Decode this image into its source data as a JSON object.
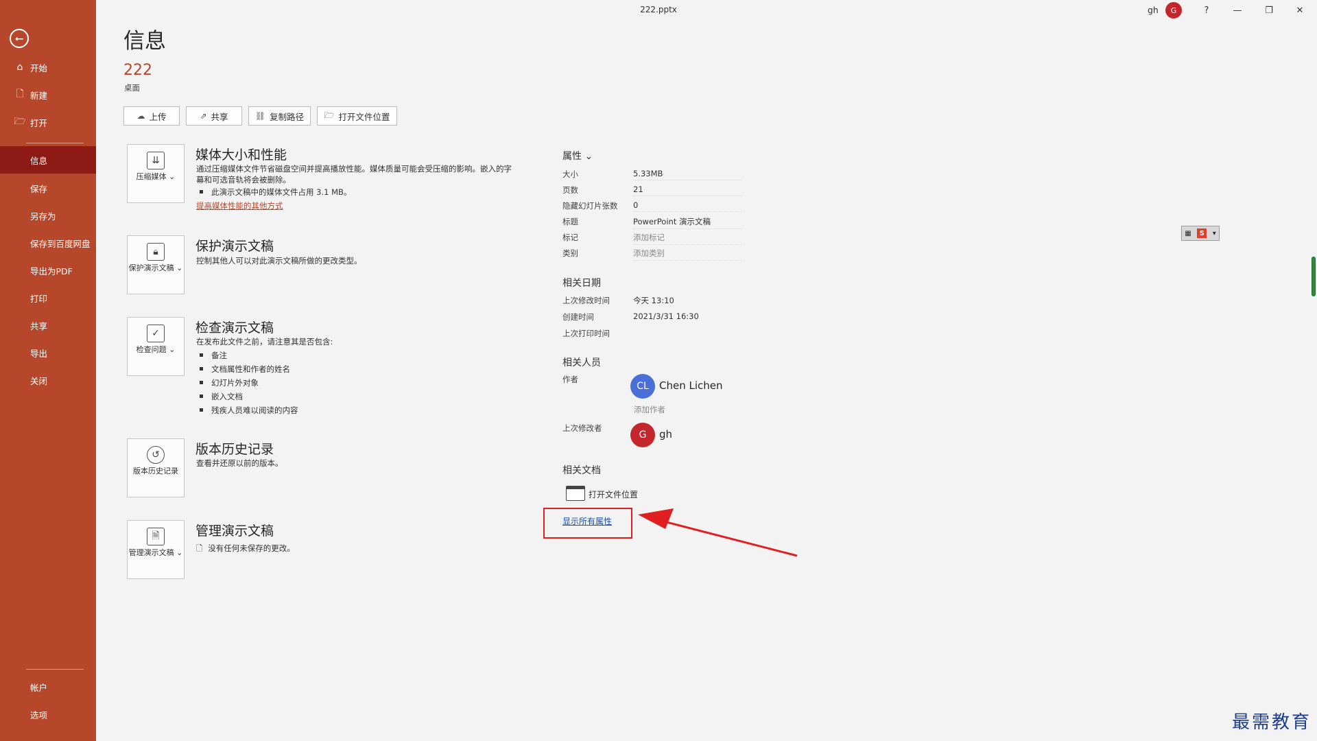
{
  "window": {
    "title": "222.pptx",
    "user": "gh",
    "user_avatar": "G",
    "help": "?",
    "minimize": "—",
    "restore": "❐",
    "close": "✕"
  },
  "sidebar": {
    "back_icon": "⭠",
    "items": [
      {
        "label": "开始",
        "icon": "⌂"
      },
      {
        "label": "新建",
        "icon": "🗋"
      },
      {
        "label": "打开",
        "icon": "🗁"
      },
      {
        "label": "信息"
      },
      {
        "label": "保存"
      },
      {
        "label": "另存为"
      },
      {
        "label": "保存到百度网盘"
      },
      {
        "label": "导出为PDF"
      },
      {
        "label": "打印"
      },
      {
        "label": "共享"
      },
      {
        "label": "导出"
      },
      {
        "label": "关闭"
      }
    ],
    "bottom": [
      {
        "label": "帐户"
      },
      {
        "label": "选项"
      }
    ],
    "colors": {
      "sidebar": "#b7472a",
      "active": "#8e1a16"
    }
  },
  "header": {
    "title": "信息",
    "file_name": "222",
    "location": "桌面",
    "buttons": [
      {
        "label": "上传",
        "icon": "☁"
      },
      {
        "label": "共享",
        "icon": "⇗"
      },
      {
        "label": "复制路径",
        "icon": "⛓"
      },
      {
        "label": "打开文件位置",
        "icon": "🗁"
      }
    ]
  },
  "sections": {
    "media": {
      "tile": "压缩媒体 ⌄",
      "title": "媒体大小和性能",
      "desc": "通过压缩媒体文件节省磁盘空间并提高播放性能。媒体质量可能会受压缩的影响。嵌入的字幕和可选音轨将会被删除。",
      "bullets": [
        "此演示文稿中的媒体文件占用 3.1 MB。"
      ],
      "link": "提高媒体性能的其他方式"
    },
    "protect": {
      "tile": "保护演示文稿 ⌄",
      "title": "保护演示文稿",
      "desc": "控制其他人可以对此演示文稿所做的更改类型。"
    },
    "inspect": {
      "tile": "检查问题 ⌄",
      "title": "检查演示文稿",
      "desc": "在发布此文件之前，请注意其是否包含:",
      "bullets": [
        "备注",
        "文档属性和作者的姓名",
        "幻灯片外对象",
        "嵌入文档",
        "残疾人员难以阅读的内容"
      ]
    },
    "history": {
      "tile": "版本历史记录",
      "title": "版本历史记录",
      "desc": "查看并还原以前的版本。"
    },
    "manage": {
      "tile": "管理演示文稿 ⌄",
      "title": "管理演示文稿",
      "desc": "没有任何未保存的更改。"
    }
  },
  "properties": {
    "heading": "属性 ⌄",
    "rows": [
      {
        "label": "大小",
        "value": "5.33MB"
      },
      {
        "label": "页数",
        "value": "21"
      },
      {
        "label": "隐藏幻灯片张数",
        "value": "0"
      },
      {
        "label": "标题",
        "value": "PowerPoint 演示文稿"
      },
      {
        "label": "标记",
        "value": "添加标记"
      },
      {
        "label": "类别",
        "value": "添加类别"
      }
    ]
  },
  "dates": {
    "heading": "相关日期",
    "rows": [
      {
        "label": "上次修改时间",
        "value": "今天 13:10"
      },
      {
        "label": "创建时间",
        "value": "2021/3/31 16:30"
      },
      {
        "label": "上次打印时间",
        "value": ""
      }
    ]
  },
  "people": {
    "heading": "相关人员",
    "author_label": "作者",
    "author_initials": "CL",
    "author_name": "Chen Lichen",
    "add_author": "添加作者",
    "modifier_label": "上次修改者",
    "modifier_initials": "G",
    "modifier_name": "gh"
  },
  "docs": {
    "heading": "相关文档",
    "open_location": "打开文件位置",
    "show_all": "显示所有属性"
  },
  "watermark": "最需教育"
}
